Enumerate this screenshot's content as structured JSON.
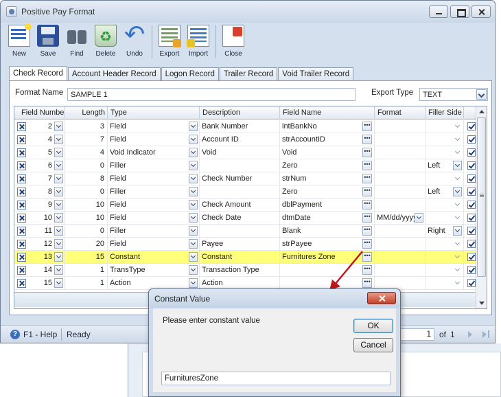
{
  "window": {
    "title": "Positive Pay Format"
  },
  "toolbar": {
    "new": "New",
    "save": "Save",
    "find": "Find",
    "delete": "Delete",
    "undo": "Undo",
    "export": "Export",
    "import": "Import",
    "close": "Close"
  },
  "tabs": [
    {
      "label": "Check Record",
      "active": true
    },
    {
      "label": "Account Header Record",
      "active": false
    },
    {
      "label": "Logon Record",
      "active": false
    },
    {
      "label": "Trailer Record",
      "active": false
    },
    {
      "label": "Void Trailer Record",
      "active": false
    }
  ],
  "form": {
    "format_name_label": "Format Name",
    "format_name_value": "SAMPLE 1",
    "export_type_label": "Export Type",
    "export_type_value": "TEXT"
  },
  "grid": {
    "columns": [
      "Field Number",
      "Length",
      "Type",
      "Description",
      "Field Name",
      "Format",
      "Filler Side"
    ],
    "rows": [
      {
        "field_number": "2",
        "length": "3",
        "type": "Field",
        "description": "Bank Number",
        "field_name": "intBankNo",
        "format": "",
        "filler_side": "",
        "checked": true,
        "selected": false
      },
      {
        "field_number": "4",
        "length": "7",
        "type": "Field",
        "description": "Account ID",
        "field_name": "strAccountID",
        "format": "",
        "filler_side": "",
        "checked": true,
        "selected": false
      },
      {
        "field_number": "5",
        "length": "4",
        "type": "Void Indicator",
        "description": "Void",
        "field_name": "Void",
        "format": "",
        "filler_side": "",
        "checked": true,
        "selected": false
      },
      {
        "field_number": "6",
        "length": "0",
        "type": "Filler",
        "description": "",
        "field_name": "Zero",
        "format": "",
        "filler_side": "Left",
        "checked": true,
        "selected": false
      },
      {
        "field_number": "7",
        "length": "8",
        "type": "Field",
        "description": "Check Number",
        "field_name": "strNum",
        "format": "",
        "filler_side": "",
        "checked": true,
        "selected": false
      },
      {
        "field_number": "8",
        "length": "0",
        "type": "Filler",
        "description": "",
        "field_name": "Zero",
        "format": "",
        "filler_side": "Left",
        "checked": true,
        "selected": false
      },
      {
        "field_number": "9",
        "length": "10",
        "type": "Field",
        "description": "Check Amount",
        "field_name": "dblPayment",
        "format": "",
        "filler_side": "",
        "checked": true,
        "selected": false
      },
      {
        "field_number": "10",
        "length": "10",
        "type": "Field",
        "description": "Check Date",
        "field_name": "dtmDate",
        "format": "MM/dd/yyyy",
        "filler_side": "",
        "checked": true,
        "selected": false
      },
      {
        "field_number": "11",
        "length": "0",
        "type": "Filler",
        "description": "",
        "field_name": "Blank",
        "format": "",
        "filler_side": "Right",
        "checked": true,
        "selected": false
      },
      {
        "field_number": "12",
        "length": "20",
        "type": "Field",
        "description": "Payee",
        "field_name": "strPayee",
        "format": "",
        "filler_side": "",
        "checked": true,
        "selected": false
      },
      {
        "field_number": "13",
        "length": "15",
        "type": "Constant",
        "description": "Constant",
        "field_name": "Furnitures Zone",
        "format": "",
        "filler_side": "",
        "checked": true,
        "selected": true
      },
      {
        "field_number": "14",
        "length": "1",
        "type": "TransType",
        "description": "Transaction Type",
        "field_name": "",
        "format": "",
        "filler_side": "",
        "checked": true,
        "selected": false
      },
      {
        "field_number": "15",
        "length": "1",
        "type": "Action",
        "description": "Action",
        "field_name": "",
        "format": "",
        "filler_side": "",
        "checked": true,
        "selected": false
      }
    ]
  },
  "statusbar": {
    "help": "F1 - Help",
    "status": "Ready",
    "page": "1",
    "of_label": "of",
    "total_pages": "1"
  },
  "dialog": {
    "title": "Constant Value",
    "prompt": "Please enter constant value",
    "ok": "OK",
    "cancel": "Cancel",
    "input_value": "FurnituresZone"
  },
  "colors": {
    "selected_row": "#ffff7a",
    "annotation_arrow": "#c0191c",
    "accent": "#3a68b8"
  }
}
